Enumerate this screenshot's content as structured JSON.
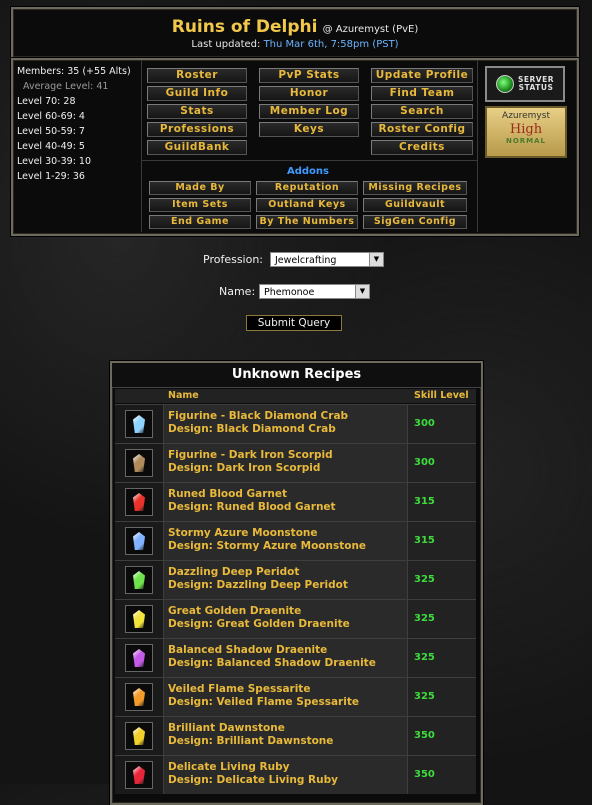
{
  "header": {
    "guild_name": "Ruins of Delphi",
    "realm": "@ Azuremyst (PvE)",
    "updated_label": "Last updated:",
    "updated_time": "Thu Mar 6th, 7:58pm (PST)"
  },
  "members": {
    "count": "Members: 35 (+55 Alts)",
    "average": "Average Level: 41",
    "levels": [
      "Level 70: 28",
      "Level 60-69: 4",
      "Level 50-59: 7",
      "Level 40-49: 5",
      "Level 30-39: 10",
      "Level 1-29: 36"
    ]
  },
  "menu": {
    "col1": [
      "Roster",
      "Guild Info",
      "Stats",
      "Professions",
      "GuildBank"
    ],
    "col2": [
      "PvP Stats",
      "Honor",
      "Member Log",
      "Keys"
    ],
    "col3": [
      "Update Profile",
      "Find Team",
      "Search",
      "Roster Config",
      "Credits"
    ],
    "addons_title": "Addons",
    "addons": [
      "Made By",
      "Reputation",
      "Missing Recipes",
      "Item Sets",
      "Outland Keys",
      "Guildvault",
      "End Game",
      "By The Numbers",
      "SigGen Config"
    ]
  },
  "server_status": {
    "label_line1": "SERVER",
    "label_line2": "STATUS"
  },
  "realm_box": {
    "name": "Azuremyst",
    "population": "High",
    "type": "NORMAL"
  },
  "form": {
    "profession_label": "Profession:",
    "profession_value": "Jewelcrafting",
    "name_label": "Name:",
    "name_value": "Phemonoe",
    "submit_label": "Submit Query"
  },
  "table": {
    "title": "Unknown Recipes",
    "col_name": "Name",
    "col_skill": "Skill Level",
    "rows": [
      {
        "name": "Figurine - Black Diamond Crab",
        "design": "Design: Black Diamond Crab",
        "skill": "300",
        "icon": "crab-figurine-icon",
        "color": "#8fd3ff"
      },
      {
        "name": "Figurine - Dark Iron Scorpid",
        "design": "Design: Dark Iron Scorpid",
        "skill": "300",
        "icon": "scorpid-figurine-icon",
        "color": "#b08a5a"
      },
      {
        "name": "Runed Blood Garnet",
        "design": "Design: Runed Blood Garnet",
        "skill": "315",
        "icon": "red-gem-icon",
        "color": "#e8322a"
      },
      {
        "name": "Stormy Azure Moonstone",
        "design": "Design: Stormy Azure Moonstone",
        "skill": "315",
        "icon": "blue-gem-icon",
        "color": "#7fb2ff"
      },
      {
        "name": "Dazzling Deep Peridot",
        "design": "Design: Dazzling Deep Peridot",
        "skill": "325",
        "icon": "green-gem-icon",
        "color": "#6ee24a"
      },
      {
        "name": "Great Golden Draenite",
        "design": "Design: Great Golden Draenite",
        "skill": "325",
        "icon": "yellow-gem-icon",
        "color": "#f2e23a"
      },
      {
        "name": "Balanced Shadow Draenite",
        "design": "Design: Balanced Shadow Draenite",
        "skill": "325",
        "icon": "purple-gem-icon",
        "color": "#c45ae8"
      },
      {
        "name": "Veiled Flame Spessarite",
        "design": "Design: Veiled Flame Spessarite",
        "skill": "325",
        "icon": "orange-gem-icon",
        "color": "#f29a2a"
      },
      {
        "name": "Brilliant Dawnstone",
        "design": "Design: Brilliant Dawnstone",
        "skill": "350",
        "icon": "gold-gem-icon",
        "color": "#f2d02a"
      },
      {
        "name": "Delicate Living Ruby",
        "design": "Design: Delicate Living Ruby",
        "skill": "350",
        "icon": "ruby-gem-icon",
        "color": "#e8263a"
      }
    ]
  }
}
